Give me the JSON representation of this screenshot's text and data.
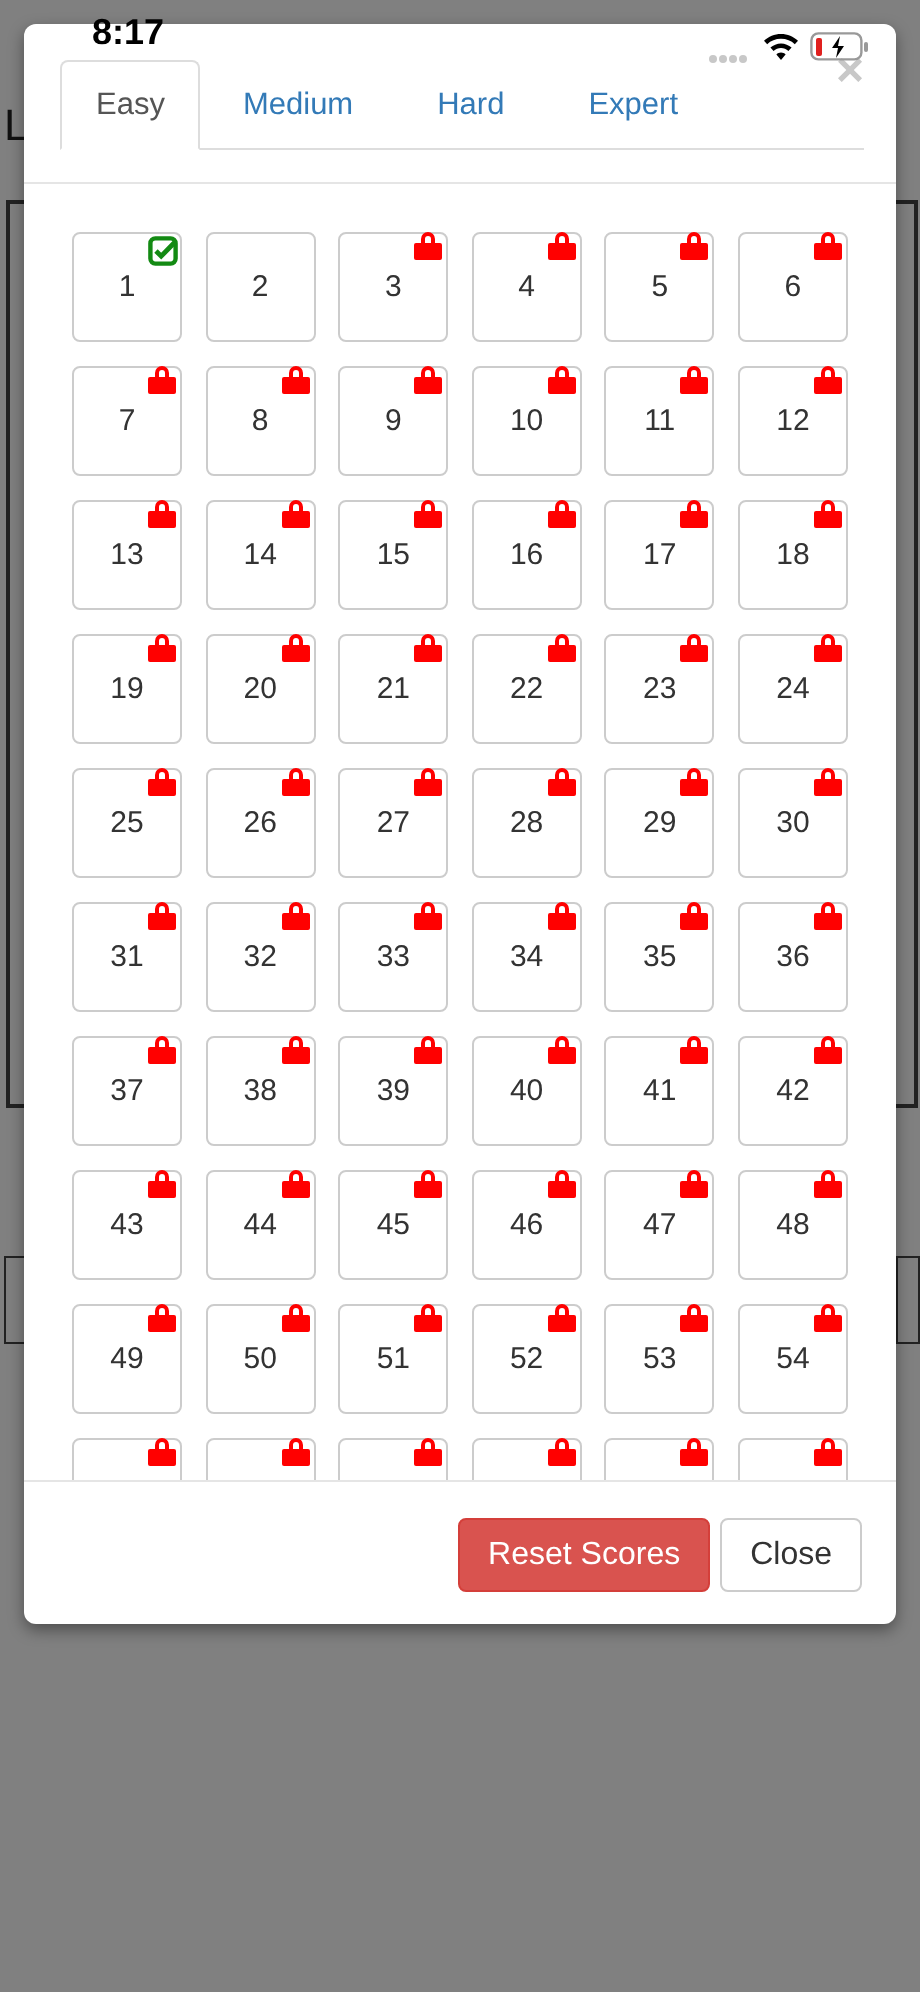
{
  "status_bar": {
    "time": "8:17"
  },
  "background": {
    "text": "L"
  },
  "tabs": [
    {
      "label": "Easy",
      "selected": true
    },
    {
      "label": "Medium",
      "selected": false
    },
    {
      "label": "Hard",
      "selected": false
    },
    {
      "label": "Expert",
      "selected": false
    }
  ],
  "close_icon": "×",
  "levels": [
    {
      "label": "1",
      "completed": true,
      "locked": false
    },
    {
      "label": "2",
      "completed": false,
      "locked": false
    },
    {
      "label": "3",
      "completed": false,
      "locked": true
    },
    {
      "label": "4",
      "completed": false,
      "locked": true
    },
    {
      "label": "5",
      "completed": false,
      "locked": true
    },
    {
      "label": "6",
      "completed": false,
      "locked": true
    },
    {
      "label": "7",
      "completed": false,
      "locked": true
    },
    {
      "label": "8",
      "completed": false,
      "locked": true
    },
    {
      "label": "9",
      "completed": false,
      "locked": true
    },
    {
      "label": "10",
      "completed": false,
      "locked": true
    },
    {
      "label": "11",
      "completed": false,
      "locked": true
    },
    {
      "label": "12",
      "completed": false,
      "locked": true
    },
    {
      "label": "13",
      "completed": false,
      "locked": true
    },
    {
      "label": "14",
      "completed": false,
      "locked": true
    },
    {
      "label": "15",
      "completed": false,
      "locked": true
    },
    {
      "label": "16",
      "completed": false,
      "locked": true
    },
    {
      "label": "17",
      "completed": false,
      "locked": true
    },
    {
      "label": "18",
      "completed": false,
      "locked": true
    },
    {
      "label": "19",
      "completed": false,
      "locked": true
    },
    {
      "label": "20",
      "completed": false,
      "locked": true
    },
    {
      "label": "21",
      "completed": false,
      "locked": true
    },
    {
      "label": "22",
      "completed": false,
      "locked": true
    },
    {
      "label": "23",
      "completed": false,
      "locked": true
    },
    {
      "label": "24",
      "completed": false,
      "locked": true
    },
    {
      "label": "25",
      "completed": false,
      "locked": true
    },
    {
      "label": "26",
      "completed": false,
      "locked": true
    },
    {
      "label": "27",
      "completed": false,
      "locked": true
    },
    {
      "label": "28",
      "completed": false,
      "locked": true
    },
    {
      "label": "29",
      "completed": false,
      "locked": true
    },
    {
      "label": "30",
      "completed": false,
      "locked": true
    },
    {
      "label": "31",
      "completed": false,
      "locked": true
    },
    {
      "label": "32",
      "completed": false,
      "locked": true
    },
    {
      "label": "33",
      "completed": false,
      "locked": true
    },
    {
      "label": "34",
      "completed": false,
      "locked": true
    },
    {
      "label": "35",
      "completed": false,
      "locked": true
    },
    {
      "label": "36",
      "completed": false,
      "locked": true
    },
    {
      "label": "37",
      "completed": false,
      "locked": true
    },
    {
      "label": "38",
      "completed": false,
      "locked": true
    },
    {
      "label": "39",
      "completed": false,
      "locked": true
    },
    {
      "label": "40",
      "completed": false,
      "locked": true
    },
    {
      "label": "41",
      "completed": false,
      "locked": true
    },
    {
      "label": "42",
      "completed": false,
      "locked": true
    },
    {
      "label": "43",
      "completed": false,
      "locked": true
    },
    {
      "label": "44",
      "completed": false,
      "locked": true
    },
    {
      "label": "45",
      "completed": false,
      "locked": true
    },
    {
      "label": "46",
      "completed": false,
      "locked": true
    },
    {
      "label": "47",
      "completed": false,
      "locked": true
    },
    {
      "label": "48",
      "completed": false,
      "locked": true
    },
    {
      "label": "49",
      "completed": false,
      "locked": true
    },
    {
      "label": "50",
      "completed": false,
      "locked": true
    },
    {
      "label": "51",
      "completed": false,
      "locked": true
    },
    {
      "label": "52",
      "completed": false,
      "locked": true
    },
    {
      "label": "53",
      "completed": false,
      "locked": true
    },
    {
      "label": "54",
      "completed": false,
      "locked": true
    },
    {
      "completed": false,
      "locked": true
    },
    {
      "completed": false,
      "locked": true
    },
    {
      "completed": false,
      "locked": true
    },
    {
      "completed": false,
      "locked": true
    },
    {
      "completed": false,
      "locked": true
    },
    {
      "completed": false,
      "locked": true
    }
  ],
  "buttons": [
    {
      "label": "Reset Scores",
      "kind": "danger"
    },
    {
      "label": "Close",
      "kind": "default"
    }
  ]
}
